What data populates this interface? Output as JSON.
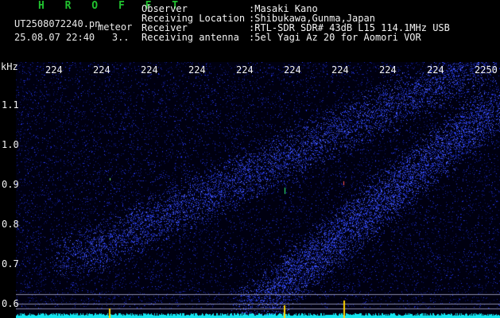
{
  "header": {
    "app_title": "H R O F F T",
    "file_name": "UT2508072240.pn",
    "tag": "meteor",
    "datetime": "25.08.07 22:40",
    "count": "3..",
    "info": [
      {
        "label": "Observer",
        "value": ":Masaki Kano"
      },
      {
        "label": "Receiving Location",
        "value": ":Shibukawa,Gunma,Japan"
      },
      {
        "label": "Receiver",
        "value": ":RTL-SDR SDR# 43dB L15 114.1MHz USB"
      },
      {
        "label": "Receiving antenna",
        "value": ":5el Yagi Az 20 for Aomori VOR"
      }
    ]
  },
  "spectrogram": {
    "y_unit": "kHz",
    "y_ticks": [
      "1.1",
      "1.0",
      "0.9",
      "0.8",
      "0.7",
      "0.6"
    ],
    "x_ticks": [
      "224",
      "224",
      "224",
      "224",
      "224",
      "224",
      "224",
      "224",
      "224",
      "2250"
    ],
    "colors": {
      "background": "#000010",
      "noise": "#1a28c8",
      "trace": "#3a54ff",
      "baseline": "#14e6f0",
      "marker": "#ffd400"
    }
  }
}
